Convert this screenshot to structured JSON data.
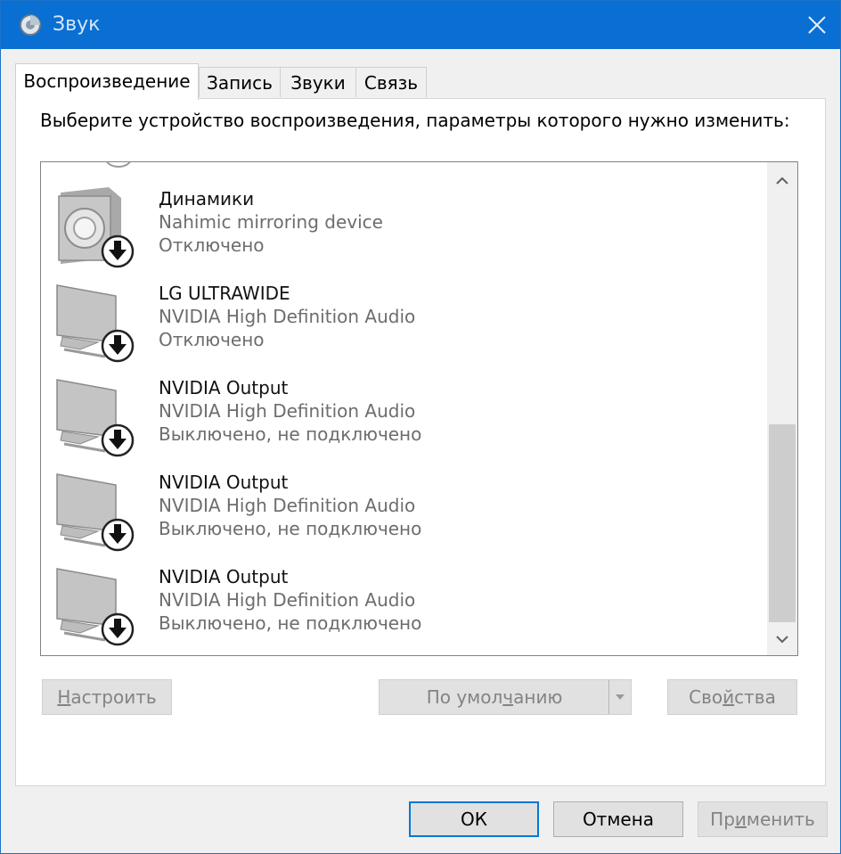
{
  "window": {
    "title": "Звук",
    "title_icon": "speaker-icon",
    "close_icon": "close-icon"
  },
  "tabs": [
    {
      "label": "Воспроизведение",
      "active": true
    },
    {
      "label": "Запись",
      "active": false
    },
    {
      "label": "Звуки",
      "active": false
    },
    {
      "label": "Связь",
      "active": false
    }
  ],
  "instruction": "Выберите устройство воспроизведения, параметры которого нужно изменить:",
  "devices": [
    {
      "name": "Динамики",
      "driver": "Nahimic mirroring device",
      "status": "Отключено",
      "icon": "speaker-device-icon"
    },
    {
      "name": "LG ULTRAWIDE",
      "driver": "NVIDIA High Definition Audio",
      "status": "Отключено",
      "icon": "monitor-device-icon"
    },
    {
      "name": "NVIDIA Output",
      "driver": "NVIDIA High Definition Audio",
      "status": "Выключено, не подключено",
      "icon": "monitor-device-icon"
    },
    {
      "name": "NVIDIA Output",
      "driver": "NVIDIA High Definition Audio",
      "status": "Выключено, не подключено",
      "icon": "monitor-device-icon"
    },
    {
      "name": "NVIDIA Output",
      "driver": "NVIDIA High Definition Audio",
      "status": "Выключено, не подключено",
      "icon": "monitor-device-icon"
    }
  ],
  "buttons": {
    "configure": {
      "prefix": "",
      "mnemonic": "Н",
      "rest": "астроить"
    },
    "default": {
      "prefix": "По умол",
      "mnemonic": "ч",
      "rest": "анию"
    },
    "properties": {
      "prefix": "Сво",
      "mnemonic": "й",
      "rest": "ства"
    },
    "ok": "ОК",
    "cancel": "Отмена",
    "apply": {
      "prefix": "Пр",
      "mnemonic": "и",
      "rest": "менить"
    }
  },
  "colors": {
    "titlebar": "#0a6fd2",
    "focus": "#0078d7"
  }
}
